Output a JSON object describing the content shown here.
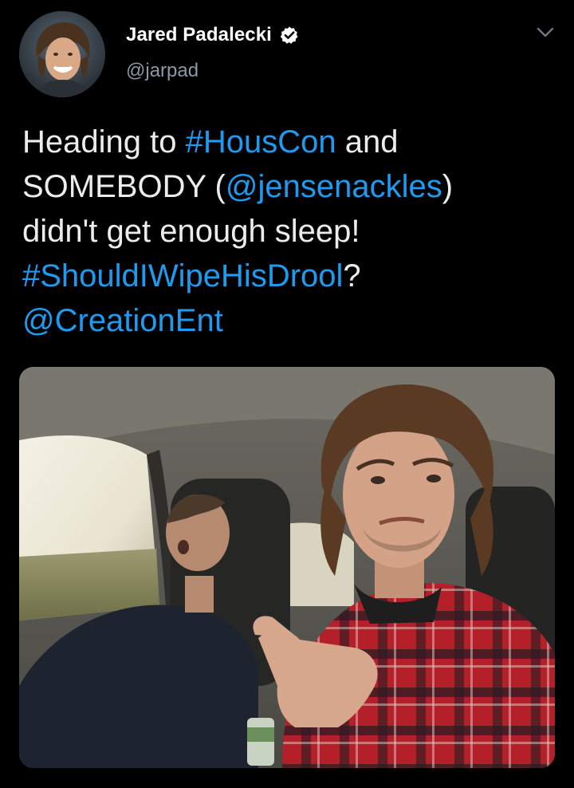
{
  "author": {
    "name": "Jared Padalecki",
    "handle": "@jarpad",
    "verified_icon": "verified-badge-icon",
    "avatar_icon": "avatar"
  },
  "menu": {
    "icon": "chevron-down-icon"
  },
  "tweet": {
    "line1": {
      "a": "Heading to ",
      "b": "#HousCon",
      "c": " and"
    },
    "line2": {
      "a": "SOMEBODY (",
      "b": "@jensenackles",
      "c": ")"
    },
    "line3": {
      "a": "didn't get enough sleep!"
    },
    "line4": {
      "a": "#ShouldIWipeHisDrool",
      "b": "?"
    },
    "line5": {
      "a": "@CreationEnt"
    }
  },
  "colors": {
    "background": "#000000",
    "link": "#1d9bf0",
    "text": "#ececec",
    "secondary": "#8b98a5"
  },
  "media": {
    "kind": "photo"
  }
}
